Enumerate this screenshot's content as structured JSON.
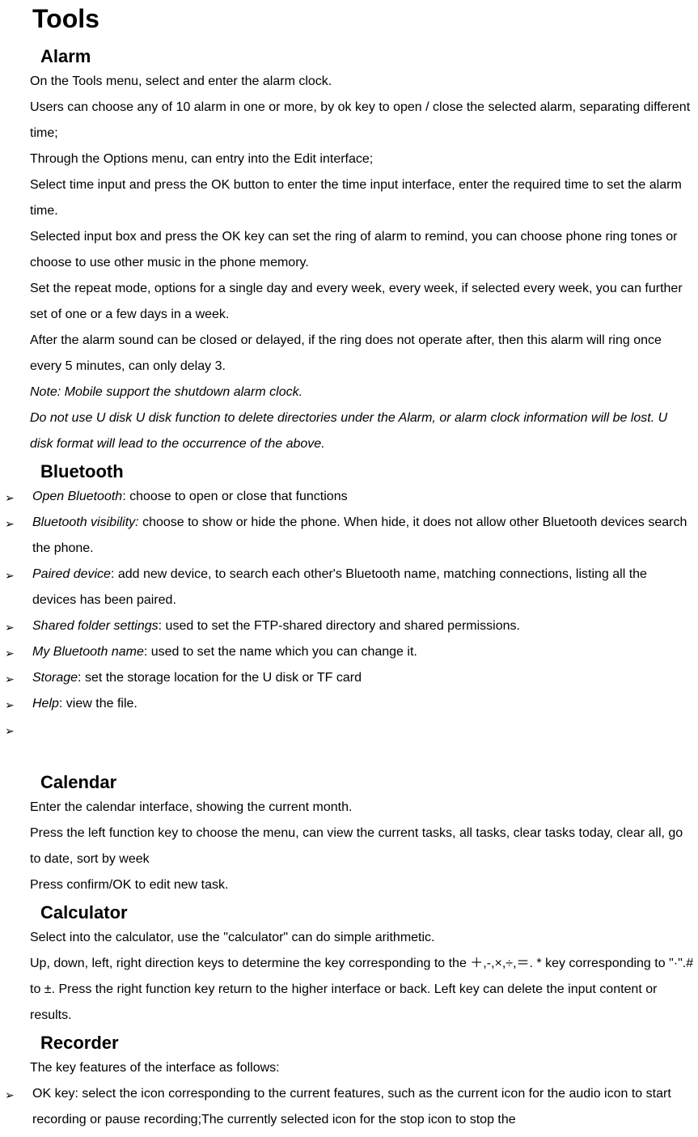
{
  "mainTitle": "Tools",
  "sections": {
    "alarm": {
      "title": "Alarm",
      "p1": "On the Tools menu, select and enter the alarm clock.",
      "p2": "Users can choose any of 10 alarm in one or more, by ok key to open / close the selected alarm, separating different time;",
      "p3": "Through the Options menu, can entry into the Edit interface;",
      "p4": "Select time input and press the OK button to enter the time input interface, enter the required time to set the alarm time.",
      "p5": "Selected input box and press the OK key can set the ring of alarm to remind, you can choose phone ring tones or choose to use other music in the phone memory.",
      "p6": "Set the repeat mode, options for a single day and every week, every week, if selected every week, you can further set of one or a few days in a week.",
      "p7": "After the alarm sound can be closed or delayed, if the ring does not operate after, then this alarm will ring once every 5 minutes, can only delay 3.",
      "note1": "Note: Mobile support the shutdown alarm clock.",
      "note2": "Do not use U disk U disk function to delete directories under the Alarm, or alarm clock information will be lost. U disk format will lead to the occurrence of the above."
    },
    "bluetooth": {
      "title": "Bluetooth",
      "items": [
        {
          "label": "Open Bluetooth",
          "text": ": choose to open or close that functions"
        },
        {
          "label": "Bluetooth visibility:",
          "text": " choose to show or hide the phone. When hide, it does not allow other Bluetooth devices search the phone."
        },
        {
          "label": "Paired device",
          "text": ": add new device, to search each other's Bluetooth name, matching connections, listing all the devices has been paired."
        },
        {
          "label": "Shared folder settings",
          "text": ": used to set the FTP-shared directory and shared permissions."
        },
        {
          "label": "My Bluetooth name",
          "text": ": used to set the name which you can change it."
        },
        {
          "label": "Storage",
          "text": ": set the storage location for the U disk or TF card"
        },
        {
          "label": "Help",
          "text": ": view the file."
        },
        {
          "label": "",
          "text": ""
        }
      ]
    },
    "calendar": {
      "title": "Calendar",
      "p1": "Enter the calendar interface, showing the current month.",
      "p2": "Press the left function key to choose the menu, can view the current tasks, all tasks, clear tasks today, clear all, go to date, sort by week",
      "p3": "Press confirm/OK to edit new task."
    },
    "calculator": {
      "title": "Calculator",
      "p1": "Select into the calculator, use the \"calculator\" can do simple arithmetic.",
      "p2": "Up, down, left, right direction keys to determine the key corresponding to the ＋,-,×,÷,＝. * key corresponding to \"·\".# to ±. Press the right function key return to the higher interface or back. Left key can delete the input content or results."
    },
    "recorder": {
      "title": "Recorder",
      "p1": "The key features of the interface as follows:",
      "items": [
        {
          "text": "OK key: select the icon corresponding to the current features, such as the current icon for the audio icon to start recording or pause recording;The currently selected icon for the stop icon to stop the"
        }
      ]
    }
  },
  "bulletMarker": "➢"
}
